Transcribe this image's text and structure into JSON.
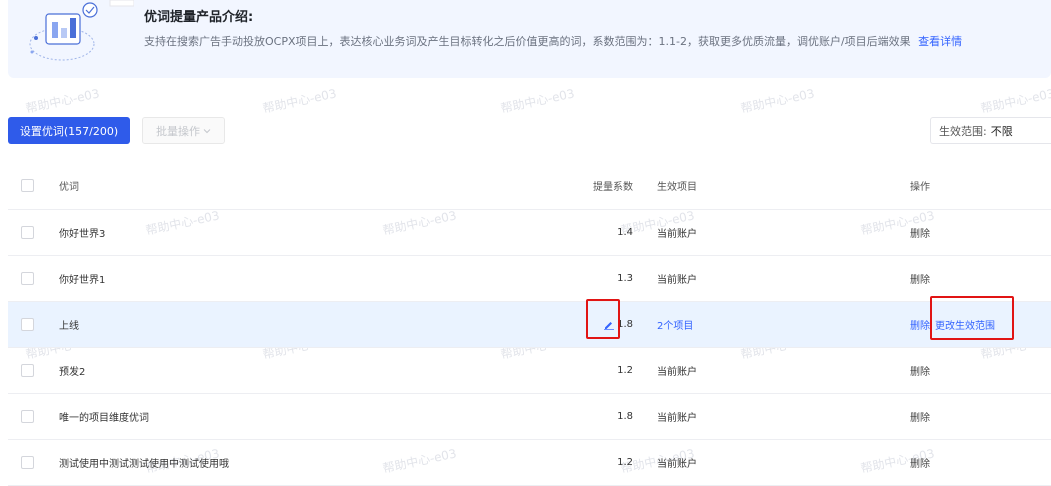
{
  "banner": {
    "title": "优词提量产品介绍:",
    "description": "支持在搜索广告手动投放OCPX项目上，表达核心业务词及产生目标转化之后价值更高的词，系数范围为：1.1-2，获取更多优质流量，调优账户/项目后端效果",
    "link": "查看详情"
  },
  "toolbar": {
    "primary_button": "设置优词(157/200)",
    "batch_button": "批量操作",
    "scope_label": "生效范围:",
    "scope_value": "不限"
  },
  "table": {
    "headers": {
      "word": "优词",
      "factor": "提量系数",
      "scope": "生效项目",
      "actions": "操作"
    },
    "rows": [
      {
        "word": "你好世界3",
        "factor": "1.4",
        "scope": "当前账户",
        "delete": "删除"
      },
      {
        "word": "你好世界1",
        "factor": "1.3",
        "scope": "当前账户",
        "delete": "删除"
      },
      {
        "word": "上线",
        "factor": "1.8",
        "scope": "2个项目",
        "delete": "删除",
        "modify": "更改生效范围"
      },
      {
        "word": "预发2",
        "factor": "1.2",
        "scope": "当前账户",
        "delete": "删除"
      },
      {
        "word": "唯一的项目维度优词",
        "factor": "1.8",
        "scope": "当前账户",
        "delete": "删除"
      },
      {
        "word": "测试使用中测试测试使用中测试使用哦",
        "factor": "1.2",
        "scope": "当前账户",
        "delete": "删除"
      }
    ]
  },
  "watermark": "帮助中心-e03",
  "colors": {
    "primary": "#2f5bea",
    "link": "#3363ff",
    "highlight_row": "#eaf3ff",
    "annotation": "#e11414"
  }
}
